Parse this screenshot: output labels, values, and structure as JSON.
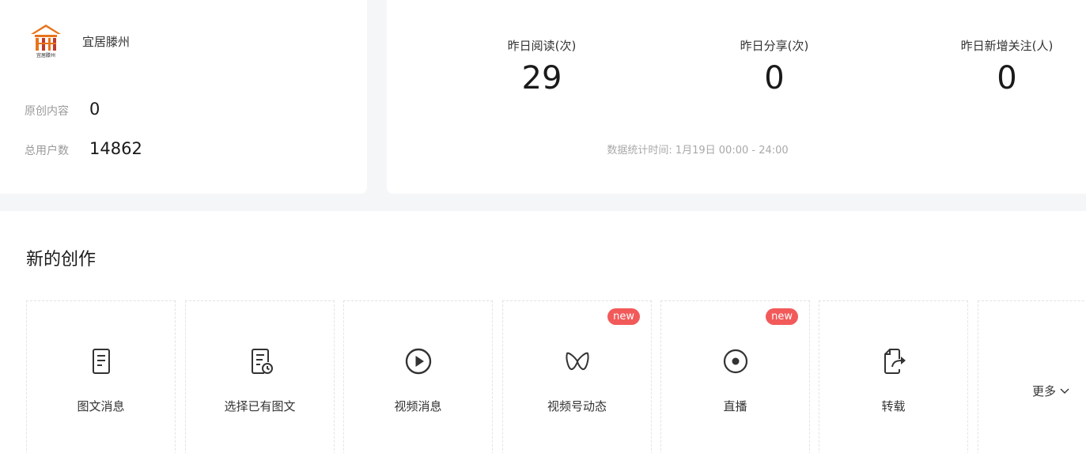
{
  "account": {
    "name": "宜居滕州",
    "logo_text": "宜居滕州",
    "original_label": "原创内容",
    "original_value": "0",
    "users_label": "总用户数",
    "users_value": "14862"
  },
  "yesterday": {
    "metrics": [
      {
        "label": "昨日阅读(次)",
        "value": "29"
      },
      {
        "label": "昨日分享(次)",
        "value": "0"
      },
      {
        "label": "昨日新增关注(人)",
        "value": "0"
      }
    ],
    "stat_time": "数据统计时间: 1月19日 00:00 - 24:00"
  },
  "create": {
    "title": "新的创作",
    "tiles": [
      {
        "label": "图文消息",
        "icon": "document-icon"
      },
      {
        "label": "选择已有图文",
        "icon": "document-clock-icon"
      },
      {
        "label": "视频消息",
        "icon": "play-circle-icon"
      },
      {
        "label": "视频号动态",
        "icon": "channels-icon",
        "badge": "new"
      },
      {
        "label": "直播",
        "icon": "live-dot-icon",
        "badge": "new"
      },
      {
        "label": "转载",
        "icon": "share-doc-icon"
      }
    ],
    "more_label": "更多"
  },
  "colors": {
    "badge": "#f25a5a",
    "logo": "#e8731c"
  }
}
